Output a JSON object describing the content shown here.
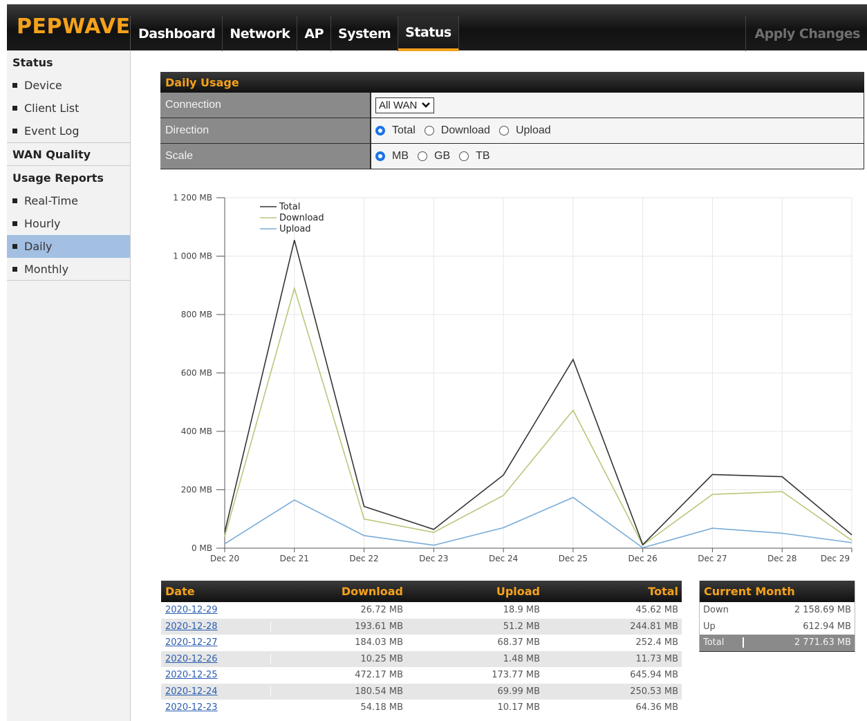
{
  "app": {
    "logo": "PEPWAVE",
    "nav": [
      {
        "label": "Dashboard"
      },
      {
        "label": "Network"
      },
      {
        "label": "AP"
      },
      {
        "label": "System"
      },
      {
        "label": "Status"
      }
    ],
    "active_nav": "Status",
    "apply_label": "Apply Changes"
  },
  "sidebar": {
    "status_header": "Status",
    "status_items": [
      "Device",
      "Client List",
      "Event Log"
    ],
    "wan_quality": "WAN Quality",
    "usage_header": "Usage Reports",
    "usage_items": [
      "Real-Time",
      "Hourly",
      "Daily",
      "Monthly"
    ],
    "active_item": "Daily"
  },
  "form": {
    "title": "Daily Usage",
    "connection_label": "Connection",
    "connection_value": "All WAN",
    "direction_label": "Direction",
    "direction_options": [
      "Total",
      "Download",
      "Upload"
    ],
    "direction_selected": "Total",
    "scale_label": "Scale",
    "scale_options": [
      "MB",
      "GB",
      "TB"
    ],
    "scale_selected": "MB"
  },
  "chart_data": {
    "type": "line",
    "x": [
      "Dec 20",
      "Dec 21",
      "Dec 22",
      "Dec 23",
      "Dec 24",
      "Dec 25",
      "Dec 26",
      "Dec 27",
      "Dec 28",
      "Dec 29"
    ],
    "y_ticks": [
      "0 MB",
      "200 MB",
      "400 MB",
      "600 MB",
      "800 MB",
      "1 000 MB",
      "1 200 MB"
    ],
    "ylim": [
      0,
      1200
    ],
    "legend_position": "top-left",
    "grid": true,
    "series": [
      {
        "name": "Total",
        "color": "#333333",
        "values": [
          55,
          1055,
          143,
          64.36,
          250.53,
          645.94,
          11.73,
          252.4,
          244.81,
          45.62
        ]
      },
      {
        "name": "Download",
        "color": "#b5c97a",
        "values": [
          40,
          890,
          100,
          54.18,
          180.54,
          472.17,
          10.25,
          184.03,
          193.61,
          26.72
        ]
      },
      {
        "name": "Upload",
        "color": "#79acd9",
        "values": [
          15,
          165,
          43,
          10.17,
          69.99,
          173.77,
          1.48,
          68.37,
          51.2,
          18.9
        ]
      }
    ]
  },
  "table": {
    "headers": {
      "date": "Date",
      "download": "Download",
      "upload": "Upload",
      "total": "Total"
    },
    "rows": [
      {
        "date": "2020-12-29",
        "download": "26.72 MB",
        "upload": "18.9 MB",
        "total": "45.62 MB"
      },
      {
        "date": "2020-12-28",
        "download": "193.61 MB",
        "upload": "51.2 MB",
        "total": "244.81 MB"
      },
      {
        "date": "2020-12-27",
        "download": "184.03 MB",
        "upload": "68.37 MB",
        "total": "252.4 MB"
      },
      {
        "date": "2020-12-26",
        "download": "10.25 MB",
        "upload": "1.48 MB",
        "total": "11.73 MB"
      },
      {
        "date": "2020-12-25",
        "download": "472.17 MB",
        "upload": "173.77 MB",
        "total": "645.94 MB"
      },
      {
        "date": "2020-12-24",
        "download": "180.54 MB",
        "upload": "69.99 MB",
        "total": "250.53 MB"
      },
      {
        "date": "2020-12-23",
        "download": "54.18 MB",
        "upload": "10.17 MB",
        "total": "64.36 MB"
      }
    ]
  },
  "current_month": {
    "title": "Current Month",
    "down_label": "Down",
    "down_value": "2 158.69 MB",
    "up_label": "Up",
    "up_value": "612.94 MB",
    "total_label": "Total",
    "total_value": "2 771.63 MB"
  }
}
